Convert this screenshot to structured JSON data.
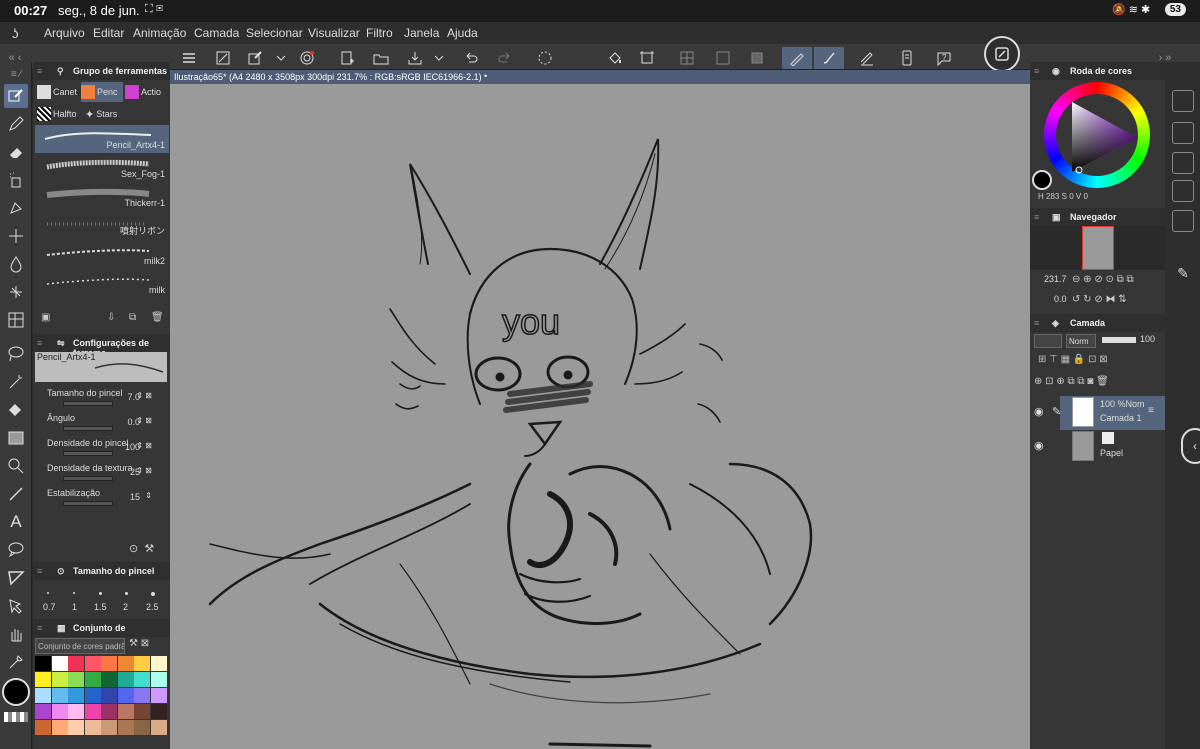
{
  "status": {
    "time": "00:27",
    "date": "seg., 8 de jun.",
    "battery": "53"
  },
  "menu": [
    "Arquivo",
    "Editar",
    "Animação",
    "Camada",
    "Selecionar",
    "Visualizar",
    "Filtro",
    "Janela",
    "Ajuda"
  ],
  "tool_group": {
    "title": "Grupo de ferramentas",
    "tabs": [
      "Canet",
      "Penc",
      "Actio",
      "Halfto",
      "Stars"
    ],
    "brushes": [
      "Pencil_Artx4-1",
      "Sex_Fog-1",
      "Thickerr-1",
      "噴射リボン",
      "milk2",
      "milk"
    ]
  },
  "tool_settings": {
    "title": "Configurações de ferrame",
    "brush_name": "Pencil_Artx4-1",
    "props": [
      {
        "label": "Tamanho do pincel",
        "value": "7.0"
      },
      {
        "label": "Ângulo",
        "value": "0.0"
      },
      {
        "label": "Densidade do pincel",
        "value": "100"
      },
      {
        "label": "Densidade da textura",
        "value": "25"
      },
      {
        "label": "Estabilização",
        "value": "15"
      }
    ]
  },
  "brush_size": {
    "title": "Tamanho do pincel",
    "sizes": [
      "0.7",
      "1",
      "1.5",
      "2",
      "2.5"
    ]
  },
  "color_set": {
    "title": "Conjunto de",
    "dropdown": "Conjunto de cores padrão"
  },
  "swatches": [
    "#000000",
    "#ffffff",
    "#ee3355",
    "#ff5566",
    "#ff7744",
    "#ee8833",
    "#ffcc44",
    "#fff6cc",
    "#ffee22",
    "#ccee44",
    "#88dd55",
    "#33aa44",
    "#116633",
    "#22aa99",
    "#44ddcc",
    "#aaffee",
    "#aaddff",
    "#66bbee",
    "#3399dd",
    "#2266cc",
    "#3344aa",
    "#5566ee",
    "#8877ee",
    "#cc99ff",
    "#aa44cc",
    "#ee88ee",
    "#ffbbee",
    "#ee44aa",
    "#993366",
    "#bb7766",
    "#774433",
    "#332222",
    "#cc6633",
    "#ffaa77",
    "#ffccaa",
    "#eebb99",
    "#cc9977",
    "#aa7755",
    "#886644",
    "#ddaa88"
  ],
  "doc": {
    "title": "Ilustração65* (A4 2480 x 3508px 300dpi 231.7% : RGB:sRGB IEC61966-2.1)"
  },
  "canvas_text": "you",
  "color_wheel": {
    "title": "Roda de cores",
    "h": "283",
    "s": "0",
    "v": "0",
    "accent": "#a020f0"
  },
  "navigator": {
    "title": "Navegador",
    "zoom": "231.7",
    "angle": "0.0"
  },
  "layers": {
    "title": "Camada",
    "blend": "Norm",
    "opacity": "100",
    "items": [
      {
        "name": "Camada 1",
        "info": "100 %Nom"
      },
      {
        "name": "Papel",
        "info": ""
      }
    ]
  }
}
